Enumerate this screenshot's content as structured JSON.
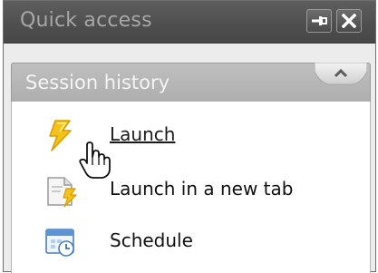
{
  "panel": {
    "title": "Quick access",
    "buttons": {
      "pin_icon": "pin-icon",
      "close_icon": "close-icon"
    }
  },
  "section": {
    "label": "Session history",
    "toggle_icon": "chevron-up-icon",
    "expanded": true
  },
  "items": [
    {
      "label": "Launch",
      "icon": "lightning-icon",
      "hovered": true
    },
    {
      "label": "Launch in a new tab",
      "icon": "new-tab-lightning-icon"
    },
    {
      "label": "Schedule",
      "icon": "calendar-clock-icon"
    }
  ],
  "colors": {
    "titlebar": "#4e4e4e",
    "title_text": "#a7a7a7",
    "section_bar": "#b3b3b3",
    "content_bg": "#ffffff",
    "lightning": "#f4c21b"
  }
}
